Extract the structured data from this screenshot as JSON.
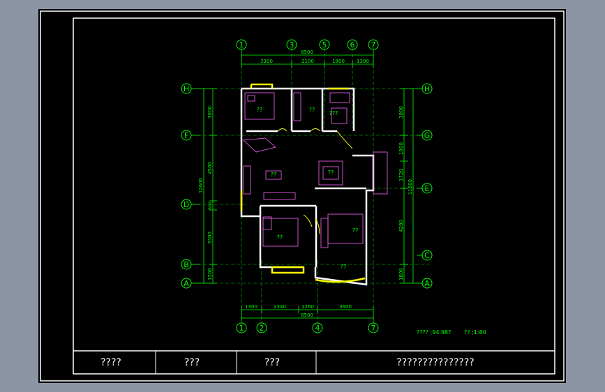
{
  "colors": {
    "background": "#000000",
    "border": "#ffffff",
    "dimension": "#00ff00",
    "walls": "#ffffff",
    "windows": "#ffff00",
    "furniture": "#ff66ff",
    "text": "#00ff00"
  },
  "grid_labels_top": [
    "1",
    "3",
    "5",
    "6",
    "7"
  ],
  "grid_labels_bottom": [
    "1",
    "2",
    "4",
    "7"
  ],
  "grid_labels_left": [
    "H",
    "F",
    "D",
    "B",
    "A"
  ],
  "grid_labels_right": [
    "H",
    "G",
    "E",
    "C",
    "A"
  ],
  "dims_top": {
    "total": "8500",
    "segments": [
      "3300",
      "2100",
      "1800",
      "1300"
    ]
  },
  "dims_bottom": {
    "total": "8500",
    "segments": [
      "1300",
      "2340",
      "1260",
      "3600"
    ]
  },
  "dims_left": {
    "total": "12600",
    "segments": [
      "3000",
      "4500",
      "600",
      "3300",
      "1200"
    ]
  },
  "dims_right": {
    "total": "11600",
    "segments": [
      "3000",
      "1800",
      "1720",
      "4280",
      "1800"
    ]
  },
  "room_labels": [
    "??",
    "??",
    "???",
    "??",
    "??",
    "??",
    "??",
    "??"
  ],
  "area_note": "????  ;94.98?",
  "scale_note": "?? ;1:80",
  "title_block": [
    "????",
    "???",
    "???",
    "???????????????"
  ]
}
